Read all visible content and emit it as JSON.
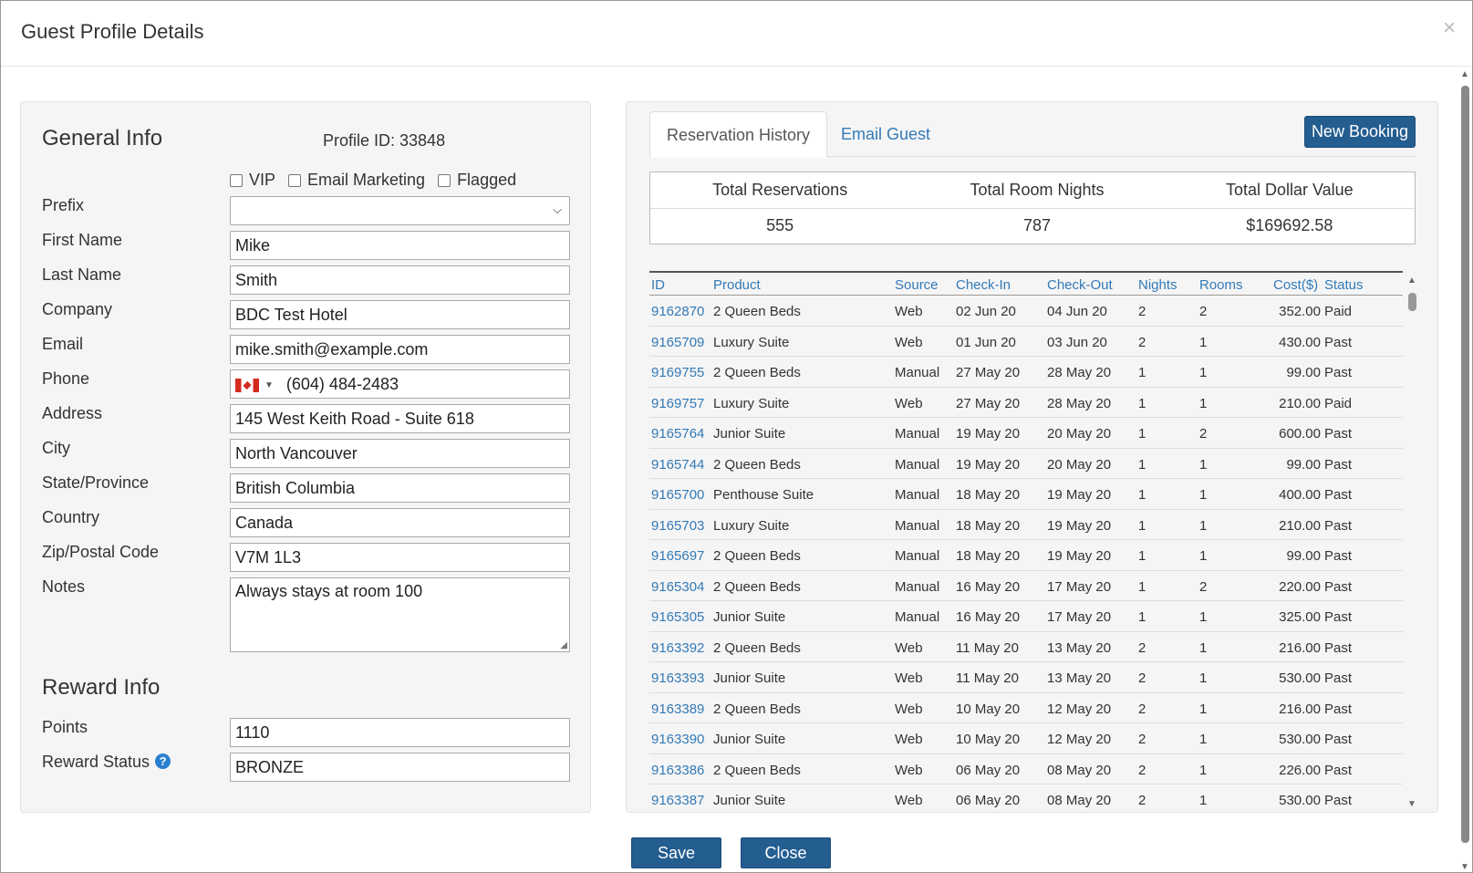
{
  "modal": {
    "title": "Guest Profile Details",
    "close_glyph": "×"
  },
  "general": {
    "title": "General Info",
    "profile_id": "Profile ID: 33848",
    "checkboxes": [
      "VIP",
      "Email Marketing",
      "Flagged"
    ],
    "labels": {
      "prefix": "Prefix",
      "first_name": "First Name",
      "last_name": "Last Name",
      "company": "Company",
      "email": "Email",
      "phone": "Phone",
      "address": "Address",
      "city": "City",
      "state": "State/Province",
      "country": "Country",
      "zip": "Zip/Postal Code",
      "notes": "Notes"
    },
    "values": {
      "prefix": "",
      "first_name": "Mike",
      "last_name": "Smith",
      "company": "BDC Test Hotel",
      "email": "mike.smith@example.com",
      "phone": "(604) 484-2483",
      "address": "145 West Keith Road - Suite 618",
      "city": "North Vancouver",
      "state": "British Columbia",
      "country": "Canada",
      "zip": "V7M 1L3",
      "notes": "Always stays at room 100"
    }
  },
  "reward": {
    "title": "Reward Info",
    "points_label": "Points",
    "points": "1110",
    "status_label": "Reward Status",
    "status": "BRONZE",
    "help_glyph": "?"
  },
  "tabs": {
    "history": "Reservation History",
    "email": "Email Guest",
    "new_booking": "New Booking"
  },
  "summary": {
    "headers": [
      "Total Reservations",
      "Total Room Nights",
      "Total Dollar Value"
    ],
    "values": [
      "555",
      "787",
      "$169692.58"
    ]
  },
  "table": {
    "headers": [
      "ID",
      "Product",
      "Source",
      "Check-In",
      "Check-Out",
      "Nights",
      "Rooms",
      "Cost($)",
      "Status"
    ],
    "rows": [
      [
        "9162870",
        "2 Queen Beds",
        "Web",
        "02 Jun 20",
        "04 Jun 20",
        "2",
        "2",
        "352.00",
        "Paid"
      ],
      [
        "9165709",
        "Luxury Suite",
        "Web",
        "01 Jun 20",
        "03 Jun 20",
        "2",
        "1",
        "430.00",
        "Past"
      ],
      [
        "9169755",
        "2 Queen Beds",
        "Manual",
        "27 May 20",
        "28 May 20",
        "1",
        "1",
        "99.00",
        "Past"
      ],
      [
        "9169757",
        "Luxury Suite",
        "Web",
        "27 May 20",
        "28 May 20",
        "1",
        "1",
        "210.00",
        "Paid"
      ],
      [
        "9165764",
        "Junior Suite",
        "Manual",
        "19 May 20",
        "20 May 20",
        "1",
        "2",
        "600.00",
        "Past"
      ],
      [
        "9165744",
        "2 Queen Beds",
        "Manual",
        "19 May 20",
        "20 May 20",
        "1",
        "1",
        "99.00",
        "Past"
      ],
      [
        "9165700",
        "Penthouse Suite",
        "Manual",
        "18 May 20",
        "19 May 20",
        "1",
        "1",
        "400.00",
        "Past"
      ],
      [
        "9165703",
        "Luxury Suite",
        "Manual",
        "18 May 20",
        "19 May 20",
        "1",
        "1",
        "210.00",
        "Past"
      ],
      [
        "9165697",
        "2 Queen Beds",
        "Manual",
        "18 May 20",
        "19 May 20",
        "1",
        "1",
        "99.00",
        "Past"
      ],
      [
        "9165304",
        "2 Queen Beds",
        "Manual",
        "16 May 20",
        "17 May 20",
        "1",
        "2",
        "220.00",
        "Past"
      ],
      [
        "9165305",
        "Junior Suite",
        "Manual",
        "16 May 20",
        "17 May 20",
        "1",
        "1",
        "325.00",
        "Past"
      ],
      [
        "9163392",
        "2 Queen Beds",
        "Web",
        "11 May 20",
        "13 May 20",
        "2",
        "1",
        "216.00",
        "Past"
      ],
      [
        "9163393",
        "Junior Suite",
        "Web",
        "11 May 20",
        "13 May 20",
        "2",
        "1",
        "530.00",
        "Past"
      ],
      [
        "9163389",
        "2 Queen Beds",
        "Web",
        "10 May 20",
        "12 May 20",
        "2",
        "1",
        "216.00",
        "Past"
      ],
      [
        "9163390",
        "Junior Suite",
        "Web",
        "10 May 20",
        "12 May 20",
        "2",
        "1",
        "530.00",
        "Past"
      ],
      [
        "9163386",
        "2 Queen Beds",
        "Web",
        "06 May 20",
        "08 May 20",
        "2",
        "1",
        "226.00",
        "Past"
      ],
      [
        "9163387",
        "Junior Suite",
        "Web",
        "06 May 20",
        "08 May 20",
        "2",
        "1",
        "530.00",
        "Past"
      ]
    ]
  },
  "footer": {
    "save": "Save",
    "close": "Close"
  },
  "colors": {
    "accent": "#245d8f",
    "link": "#337ab7",
    "help": "#2a7fd0"
  }
}
